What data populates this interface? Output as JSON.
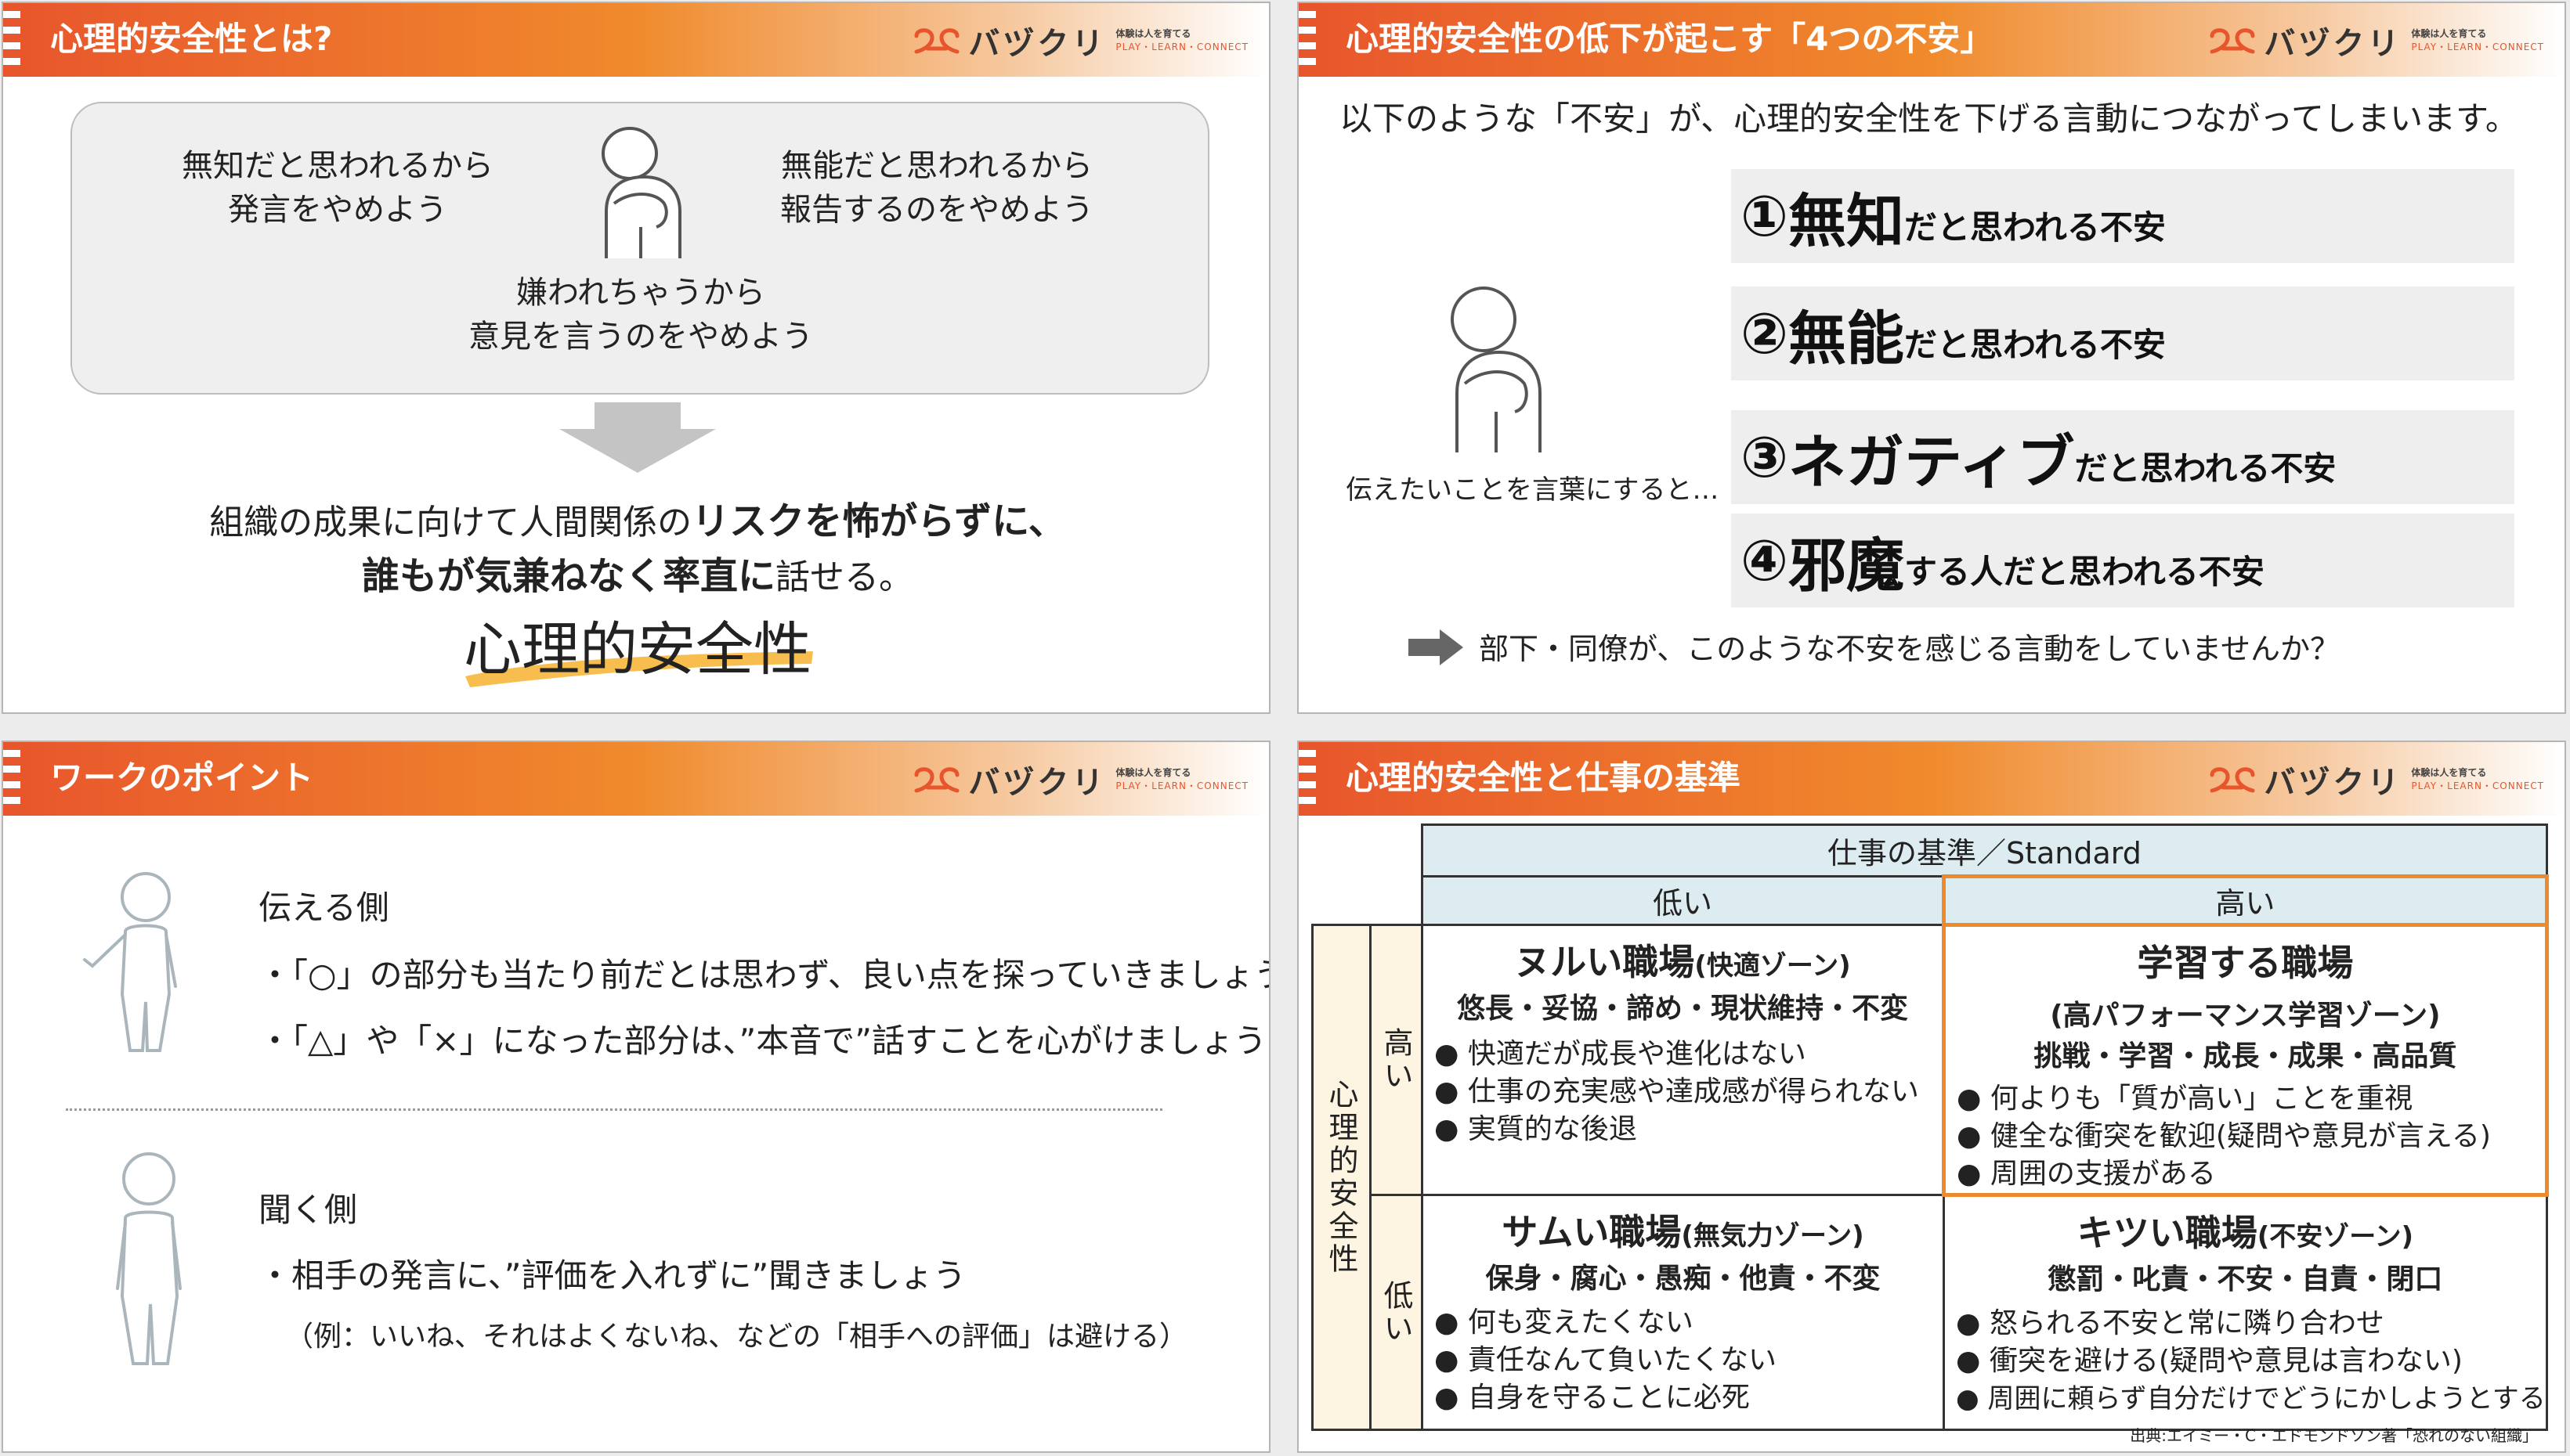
{
  "brand": {
    "logo_text": "バヅクリ",
    "tagline": "体験は人を育てる",
    "subline": "PLAY・LEARN・CONNECT",
    "accent": "#e8552c",
    "accent2": "#f08a2c"
  },
  "slide1": {
    "title": "心理的安全性とは?",
    "quote_left": [
      "無知だと思われるから",
      "発言をやめよう"
    ],
    "quote_right": [
      "無能だと思われるから",
      "報告するのをやめよう"
    ],
    "quote_center": [
      "嫌われちゃうから",
      "意見を言うのをやめよう"
    ],
    "concl_line1_pre": "組織の成果に向けて人間関係の",
    "concl_line1_bold": "リスクを怖がらずに、",
    "concl_line2_bold": "誰もが気兼ねなく率直に",
    "concl_line2_post": "話せる。",
    "keyword": "心理的安全性"
  },
  "slide2": {
    "title": "心理的安全性の低下が起こす「4つの不安」",
    "lead": "以下のような「不安」が、心理的安全性を下げる言動につながってしまいます。",
    "anxieties": [
      {
        "num": "①",
        "key": "無知",
        "rest": "だと思われる不安"
      },
      {
        "num": "②",
        "key": "無能",
        "rest": "だと思われる不安"
      },
      {
        "num": "③",
        "key": "ネガティブ",
        "rest": "だと思われる不安"
      },
      {
        "num": "④",
        "key": "邪魔",
        "rest": "する人だと思われる不安"
      }
    ],
    "caption": "伝えたいことを言葉にすると…",
    "question": "部下・同僚が、このような不安を感じる言動をしていませんか？"
  },
  "slide3": {
    "title": "ワークのポイント",
    "speaker_heading": "伝える側",
    "speaker_points": [
      "・「○」の部分も当たり前だとは思わず、良い点を探っていきましょう",
      "・「△」や「×」になった部分は、”本音で”話すことを心がけましょう"
    ],
    "listener_heading": "聞く側",
    "listener_points": [
      "・相手の発言に、”評価を入れずに”聞きましょう",
      "（例：いいね、それはよくないね、などの「相手への評価」は避ける）"
    ]
  },
  "slide4": {
    "title": "心理的安全性と仕事の基準",
    "col_header": "仕事の基準／Standard",
    "col_low": "低い",
    "col_high": "高い",
    "row_header": "心理的安全性",
    "row_high": "高い",
    "row_low": "低い",
    "zones": {
      "lukewarm": {
        "name": "ヌルい職場",
        "zone": "(快適ゾーン)",
        "keywords": "悠長・妥協・諦め・現状維持・不変",
        "points": [
          "快適だが成長や進化はない",
          "仕事の充実感や達成感が得られない",
          "実質的な後退"
        ]
      },
      "learning": {
        "name": "学習する職場",
        "zone": "(高パフォーマンス学習ゾーン)",
        "keywords": "挑戦・学習・成長・成果・高品質",
        "points": [
          "何よりも「質が高い」ことを重視",
          "健全な衝突を歓迎(疑問や意見が言える)",
          "周囲の支援がある"
        ]
      },
      "cold": {
        "name": "サムい職場",
        "zone": "(無気力ゾーン)",
        "keywords": "保身・腐心・愚痴・他責・不変",
        "points": [
          "何も変えたくない",
          "責任なんて負いたくない",
          "自身を守ることに必死"
        ]
      },
      "harsh": {
        "name": "キツい職場",
        "zone": "(不安ゾーン)",
        "keywords": "懲罰・叱責・不安・自責・閉口",
        "points": [
          "怒られる不安と常に隣り合わせ",
          "衝突を避ける(疑問や意見は言わない)",
          "周囲に頼らず自分だけでどうにかしようとする"
        ]
      }
    },
    "source": "出典:エイミー・C・エドモンドソン著「恐れのない組織」"
  }
}
